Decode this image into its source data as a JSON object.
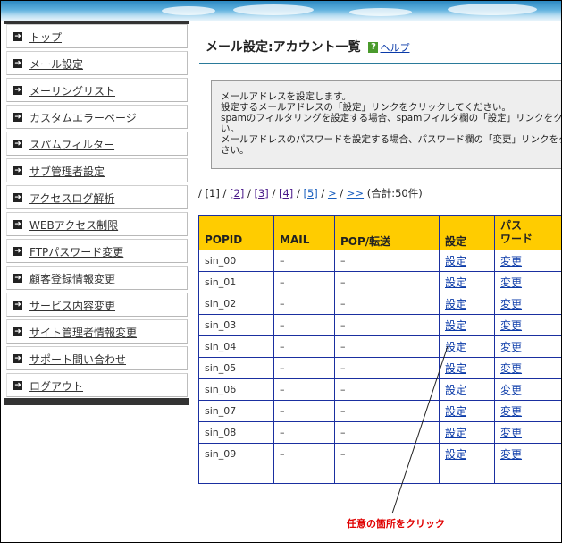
{
  "nav": [
    {
      "label": "トップ"
    },
    {
      "label": "メール設定"
    },
    {
      "label": "メーリングリスト"
    },
    {
      "label": "カスタムエラーページ"
    },
    {
      "label": "スパムフィルター"
    },
    {
      "label": "サブ管理者設定"
    },
    {
      "label": "アクセスログ解析"
    },
    {
      "label": "WEBアクセス制限"
    },
    {
      "label": "FTPパスワード変更"
    },
    {
      "label": "顧客登録情報変更"
    },
    {
      "label": "サービス内容変更"
    },
    {
      "label": "サイト管理者情報変更"
    },
    {
      "label": "サポート問い合わせ"
    },
    {
      "label": "ログアウト"
    }
  ],
  "page": {
    "title": "メール設定:アカウント一覧",
    "help_icon": "?",
    "help_label": "ヘルプ"
  },
  "info": {
    "lines": [
      "メールアドレスを設定します。",
      "設定するメールアドレスの「設定」リンクをクリックしてください。",
      "spamのフィルタリングを設定する場合、spamフィルタ欄の「設定」リンクをクリ",
      "い。",
      "メールアドレスのパスワードを設定する場合、パスワード欄の「変更」リンクをク",
      "さい。"
    ]
  },
  "pager": {
    "sep": "/",
    "current": "[1]",
    "pages": [
      "[2]",
      "[3]",
      "[4]",
      "[5]"
    ],
    "next": ">",
    "last": ">>",
    "total": "(合計:50件)"
  },
  "table": {
    "headers": [
      "POPID",
      "MAIL",
      "POP/転送",
      "設定",
      "パス\nワード"
    ],
    "rows": [
      {
        "popid": "sin_00",
        "mail": "–",
        "pop": "–",
        "setting": "設定",
        "password": "変更"
      },
      {
        "popid": "sin_01",
        "mail": "–",
        "pop": "–",
        "setting": "設定",
        "password": "変更"
      },
      {
        "popid": "sin_02",
        "mail": "–",
        "pop": "–",
        "setting": "設定",
        "password": "変更"
      },
      {
        "popid": "sin_03",
        "mail": "–",
        "pop": "–",
        "setting": "設定",
        "password": "変更"
      },
      {
        "popid": "sin_04",
        "mail": "–",
        "pop": "–",
        "setting": "設定",
        "password": "変更"
      },
      {
        "popid": "sin_05",
        "mail": "–",
        "pop": "–",
        "setting": "設定",
        "password": "変更"
      },
      {
        "popid": "sin_06",
        "mail": "–",
        "pop": "–",
        "setting": "設定",
        "password": "変更"
      },
      {
        "popid": "sin_07",
        "mail": "–",
        "pop": "–",
        "setting": "設定",
        "password": "変更"
      },
      {
        "popid": "sin_08",
        "mail": "–",
        "pop": "–",
        "setting": "設定",
        "password": "変更"
      },
      {
        "popid": "sin_09",
        "mail": "–",
        "pop": "–",
        "setting": "設定",
        "password": "変更"
      }
    ]
  },
  "callout": {
    "text": "任意の箇所をクリック",
    "color": "#e00000"
  },
  "colors": {
    "header_bg": "#ffcc00",
    "table_border": "#1a2fa0",
    "link": "#0a3aa8"
  }
}
